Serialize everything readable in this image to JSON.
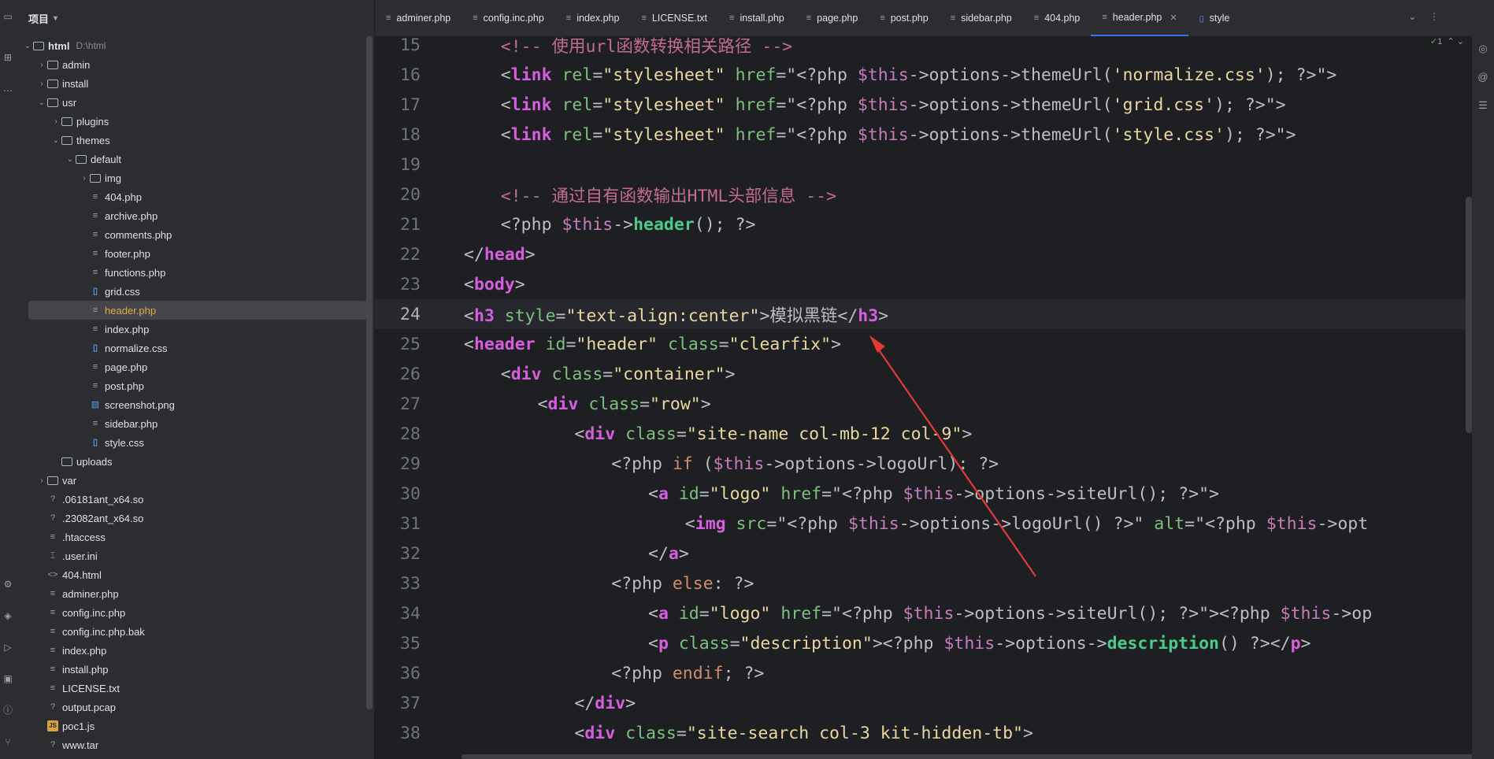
{
  "sidebar": {
    "title": "项目",
    "tree": [
      {
        "label": "html",
        "hint": "D:\\html",
        "type": "folder",
        "open": true,
        "depth": 0,
        "bold": true
      },
      {
        "label": "admin",
        "type": "folder",
        "open": false,
        "depth": 1
      },
      {
        "label": "install",
        "type": "folder",
        "open": false,
        "depth": 1
      },
      {
        "label": "usr",
        "type": "folder",
        "open": true,
        "depth": 1
      },
      {
        "label": "plugins",
        "type": "folder",
        "open": false,
        "depth": 2
      },
      {
        "label": "themes",
        "type": "folder",
        "open": true,
        "depth": 2
      },
      {
        "label": "default",
        "type": "folder",
        "open": true,
        "depth": 3
      },
      {
        "label": "img",
        "type": "folder",
        "open": false,
        "depth": 4
      },
      {
        "label": "404.php",
        "type": "php",
        "depth": 4
      },
      {
        "label": "archive.php",
        "type": "php",
        "depth": 4
      },
      {
        "label": "comments.php",
        "type": "php",
        "depth": 4
      },
      {
        "label": "footer.php",
        "type": "php",
        "depth": 4
      },
      {
        "label": "functions.php",
        "type": "php",
        "depth": 4
      },
      {
        "label": "grid.css",
        "type": "css",
        "depth": 4
      },
      {
        "label": "header.php",
        "type": "php",
        "depth": 4,
        "selected": true
      },
      {
        "label": "index.php",
        "type": "php",
        "depth": 4
      },
      {
        "label": "normalize.css",
        "type": "css",
        "depth": 4
      },
      {
        "label": "page.php",
        "type": "php",
        "depth": 4
      },
      {
        "label": "post.php",
        "type": "php",
        "depth": 4
      },
      {
        "label": "screenshot.png",
        "type": "png",
        "depth": 4
      },
      {
        "label": "sidebar.php",
        "type": "php",
        "depth": 4
      },
      {
        "label": "style.css",
        "type": "css",
        "depth": 4
      },
      {
        "label": "uploads",
        "type": "folder",
        "noarrow": true,
        "depth": 2
      },
      {
        "label": "var",
        "type": "folder",
        "open": false,
        "depth": 1
      },
      {
        "label": ".06181ant_x64.so",
        "type": "unknown",
        "depth": 1
      },
      {
        "label": ".23082ant_x64.so",
        "type": "unknown",
        "depth": 1
      },
      {
        "label": ".htaccess",
        "type": "text",
        "depth": 1
      },
      {
        "label": ".user.ini",
        "type": "ini",
        "depth": 1
      },
      {
        "label": "404.html",
        "type": "html",
        "depth": 1
      },
      {
        "label": "adminer.php",
        "type": "php",
        "depth": 1
      },
      {
        "label": "config.inc.php",
        "type": "php",
        "depth": 1
      },
      {
        "label": "config.inc.php.bak",
        "type": "text",
        "depth": 1
      },
      {
        "label": "index.php",
        "type": "php",
        "depth": 1
      },
      {
        "label": "install.php",
        "type": "php",
        "depth": 1
      },
      {
        "label": "LICENSE.txt",
        "type": "text",
        "depth": 1
      },
      {
        "label": "output.pcap",
        "type": "unknown",
        "depth": 1
      },
      {
        "label": "poc1.js",
        "type": "js",
        "depth": 1
      },
      {
        "label": "www.tar",
        "type": "unknown",
        "depth": 1
      }
    ]
  },
  "tabs": [
    {
      "label": "adminer.php",
      "icon": "php-file-icon"
    },
    {
      "label": "config.inc.php",
      "icon": "php-file-icon"
    },
    {
      "label": "index.php",
      "icon": "php-file-icon"
    },
    {
      "label": "LICENSE.txt",
      "icon": "text-file-icon"
    },
    {
      "label": "install.php",
      "icon": "php-file-icon"
    },
    {
      "label": "page.php",
      "icon": "php-file-icon"
    },
    {
      "label": "post.php",
      "icon": "php-file-icon"
    },
    {
      "label": "sidebar.php",
      "icon": "php-file-icon"
    },
    {
      "label": "404.php",
      "icon": "php-file-icon"
    },
    {
      "label": "header.php",
      "icon": "php-file-icon",
      "active": true
    },
    {
      "label": "style",
      "icon": "css-file-icon"
    }
  ],
  "inspection": {
    "count": "1"
  },
  "code": {
    "current_line": 24,
    "lines": [
      {
        "n": "15",
        "indent": 4,
        "parts": [
          [
            "comment",
            "<!-- 使用url函数转换相关路径 -->"
          ]
        ]
      },
      {
        "n": "16",
        "indent": 4,
        "parts": [
          [
            "plain",
            "<"
          ],
          [
            "tagname",
            "link"
          ],
          [
            "plain",
            " "
          ],
          [
            "attr",
            "rel"
          ],
          [
            "plain",
            "="
          ],
          [
            "strv",
            "\"stylesheet\""
          ],
          [
            "plain",
            " "
          ],
          [
            "attr",
            "href"
          ],
          [
            "plain",
            "=\""
          ],
          [
            "php",
            "<?php "
          ],
          [
            "var",
            "$this"
          ],
          [
            "plain",
            "->"
          ],
          [
            "plain",
            "options->themeUrl("
          ],
          [
            "strv",
            "'normalize.css'"
          ],
          [
            "plain",
            "); ?>\">"
          ]
        ]
      },
      {
        "n": "17",
        "indent": 4,
        "parts": [
          [
            "plain",
            "<"
          ],
          [
            "tagname",
            "link"
          ],
          [
            "plain",
            " "
          ],
          [
            "attr",
            "rel"
          ],
          [
            "plain",
            "="
          ],
          [
            "strv",
            "\"stylesheet\""
          ],
          [
            "plain",
            " "
          ],
          [
            "attr",
            "href"
          ],
          [
            "plain",
            "=\""
          ],
          [
            "php",
            "<?php "
          ],
          [
            "var",
            "$this"
          ],
          [
            "plain",
            "->"
          ],
          [
            "plain",
            "options->themeUrl("
          ],
          [
            "strv",
            "'grid.css'"
          ],
          [
            "plain",
            "); ?>\">"
          ]
        ]
      },
      {
        "n": "18",
        "indent": 4,
        "parts": [
          [
            "plain",
            "<"
          ],
          [
            "tagname",
            "link"
          ],
          [
            "plain",
            " "
          ],
          [
            "attr",
            "rel"
          ],
          [
            "plain",
            "="
          ],
          [
            "strv",
            "\"stylesheet\""
          ],
          [
            "plain",
            " "
          ],
          [
            "attr",
            "href"
          ],
          [
            "plain",
            "=\""
          ],
          [
            "php",
            "<?php "
          ],
          [
            "var",
            "$this"
          ],
          [
            "plain",
            "->"
          ],
          [
            "plain",
            "options->themeUrl("
          ],
          [
            "strv",
            "'style.css'"
          ],
          [
            "plain",
            "); ?>\">"
          ]
        ]
      },
      {
        "n": "19",
        "indent": 0,
        "parts": []
      },
      {
        "n": "20",
        "indent": 4,
        "parts": [
          [
            "comment",
            "<!-- 通过自有函数输出HTML头部信息 -->"
          ]
        ]
      },
      {
        "n": "21",
        "indent": 4,
        "parts": [
          [
            "php",
            "<?php "
          ],
          [
            "var",
            "$this"
          ],
          [
            "plain",
            "->"
          ],
          [
            "green",
            "header"
          ],
          [
            "plain",
            "(); ?>"
          ]
        ]
      },
      {
        "n": "22",
        "indent": 0,
        "parts": [
          [
            "plain",
            "</"
          ],
          [
            "tagname",
            "head"
          ],
          [
            "plain",
            ">"
          ]
        ]
      },
      {
        "n": "23",
        "indent": 0,
        "parts": [
          [
            "plain",
            "<"
          ],
          [
            "tagname",
            "body"
          ],
          [
            "plain",
            ">"
          ]
        ]
      },
      {
        "n": "24",
        "indent": 0,
        "parts": [
          [
            "plain",
            "<"
          ],
          [
            "tagname",
            "h3"
          ],
          [
            "plain",
            " "
          ],
          [
            "attr",
            "style"
          ],
          [
            "plain",
            "="
          ],
          [
            "strv",
            "\"text-align:center\""
          ],
          [
            "plain",
            ">模拟黑链</"
          ],
          [
            "tagname",
            "h3"
          ],
          [
            "plain",
            ">"
          ]
        ]
      },
      {
        "n": "25",
        "indent": 0,
        "parts": [
          [
            "plain",
            "<"
          ],
          [
            "tagname",
            "header"
          ],
          [
            "plain",
            " "
          ],
          [
            "attr",
            "id"
          ],
          [
            "plain",
            "="
          ],
          [
            "strv",
            "\"header\""
          ],
          [
            "plain",
            " "
          ],
          [
            "attr",
            "class"
          ],
          [
            "plain",
            "="
          ],
          [
            "strv",
            "\"clearfix\""
          ],
          [
            "plain",
            ">"
          ]
        ]
      },
      {
        "n": "26",
        "indent": 4,
        "parts": [
          [
            "plain",
            "<"
          ],
          [
            "tagname",
            "div"
          ],
          [
            "plain",
            " "
          ],
          [
            "attr",
            "class"
          ],
          [
            "plain",
            "="
          ],
          [
            "strv",
            "\"container\""
          ],
          [
            "plain",
            ">"
          ]
        ]
      },
      {
        "n": "27",
        "indent": 8,
        "parts": [
          [
            "plain",
            "<"
          ],
          [
            "tagname",
            "div"
          ],
          [
            "plain",
            " "
          ],
          [
            "attr",
            "class"
          ],
          [
            "plain",
            "="
          ],
          [
            "strv",
            "\"row\""
          ],
          [
            "plain",
            ">"
          ]
        ]
      },
      {
        "n": "28",
        "indent": 12,
        "parts": [
          [
            "plain",
            "<"
          ],
          [
            "tagname",
            "div"
          ],
          [
            "plain",
            " "
          ],
          [
            "attr",
            "class"
          ],
          [
            "plain",
            "="
          ],
          [
            "strv",
            "\"site-name col-mb-12 col-9\""
          ],
          [
            "plain",
            ">"
          ]
        ]
      },
      {
        "n": "29",
        "indent": 16,
        "parts": [
          [
            "php",
            "<?php "
          ],
          [
            "kw",
            "if"
          ],
          [
            "plain",
            " ("
          ],
          [
            "var",
            "$this"
          ],
          [
            "plain",
            "->options->logoUrl): ?>"
          ]
        ]
      },
      {
        "n": "30",
        "indent": 20,
        "parts": [
          [
            "plain",
            "<"
          ],
          [
            "tagname",
            "a"
          ],
          [
            "plain",
            " "
          ],
          [
            "attr",
            "id"
          ],
          [
            "plain",
            "="
          ],
          [
            "strv",
            "\"logo\""
          ],
          [
            "plain",
            " "
          ],
          [
            "attr",
            "href"
          ],
          [
            "plain",
            "=\""
          ],
          [
            "php",
            "<?php "
          ],
          [
            "var",
            "$this"
          ],
          [
            "plain",
            "->options->siteUrl(); ?>\">"
          ]
        ]
      },
      {
        "n": "31",
        "indent": 24,
        "parts": [
          [
            "plain",
            "<"
          ],
          [
            "tagname",
            "img"
          ],
          [
            "plain",
            " "
          ],
          [
            "attr",
            "src"
          ],
          [
            "plain",
            "=\""
          ],
          [
            "php",
            "<?php "
          ],
          [
            "var",
            "$this"
          ],
          [
            "plain",
            "->options->logoUrl() ?>\" "
          ],
          [
            "attr",
            "alt"
          ],
          [
            "plain",
            "=\""
          ],
          [
            "php",
            "<?php "
          ],
          [
            "var",
            "$this"
          ],
          [
            "plain",
            "->opt"
          ]
        ]
      },
      {
        "n": "32",
        "indent": 20,
        "parts": [
          [
            "plain",
            "</"
          ],
          [
            "tagname",
            "a"
          ],
          [
            "plain",
            ">"
          ]
        ]
      },
      {
        "n": "33",
        "indent": 16,
        "parts": [
          [
            "php",
            "<?php "
          ],
          [
            "kw",
            "else"
          ],
          [
            "plain",
            ": ?>"
          ]
        ]
      },
      {
        "n": "34",
        "indent": 20,
        "parts": [
          [
            "plain",
            "<"
          ],
          [
            "tagname",
            "a"
          ],
          [
            "plain",
            " "
          ],
          [
            "attr",
            "id"
          ],
          [
            "plain",
            "="
          ],
          [
            "strv",
            "\"logo\""
          ],
          [
            "plain",
            " "
          ],
          [
            "attr",
            "href"
          ],
          [
            "plain",
            "=\""
          ],
          [
            "php",
            "<?php "
          ],
          [
            "var",
            "$this"
          ],
          [
            "plain",
            "->options->siteUrl(); ?>\">"
          ],
          [
            "php",
            "<?php "
          ],
          [
            "var",
            "$this"
          ],
          [
            "plain",
            "->op"
          ]
        ]
      },
      {
        "n": "35",
        "indent": 20,
        "parts": [
          [
            "plain",
            "<"
          ],
          [
            "tagname",
            "p"
          ],
          [
            "plain",
            " "
          ],
          [
            "attr",
            "class"
          ],
          [
            "plain",
            "="
          ],
          [
            "strv",
            "\"description\""
          ],
          [
            "plain",
            ">"
          ],
          [
            "php",
            "<?php "
          ],
          [
            "var",
            "$this"
          ],
          [
            "plain",
            "->options->"
          ],
          [
            "green",
            "description"
          ],
          [
            "plain",
            "() ?></"
          ],
          [
            "tagname",
            "p"
          ],
          [
            "plain",
            ">"
          ]
        ]
      },
      {
        "n": "36",
        "indent": 16,
        "parts": [
          [
            "php",
            "<?php "
          ],
          [
            "kw",
            "endif"
          ],
          [
            "plain",
            "; ?>"
          ]
        ]
      },
      {
        "n": "37",
        "indent": 12,
        "parts": [
          [
            "plain",
            "</"
          ],
          [
            "tagname",
            "div"
          ],
          [
            "plain",
            ">"
          ]
        ]
      },
      {
        "n": "38",
        "indent": 12,
        "parts": [
          [
            "plain",
            "<"
          ],
          [
            "tagname",
            "div"
          ],
          [
            "plain",
            " "
          ],
          [
            "attr",
            "class"
          ],
          [
            "plain",
            "="
          ],
          [
            "strv",
            "\"site-search col-3 kit-hidden-tb\""
          ],
          [
            "plain",
            ">"
          ]
        ]
      }
    ]
  },
  "colors": {
    "accent": "#3574f0",
    "annotation_arrow": "#e53935"
  }
}
